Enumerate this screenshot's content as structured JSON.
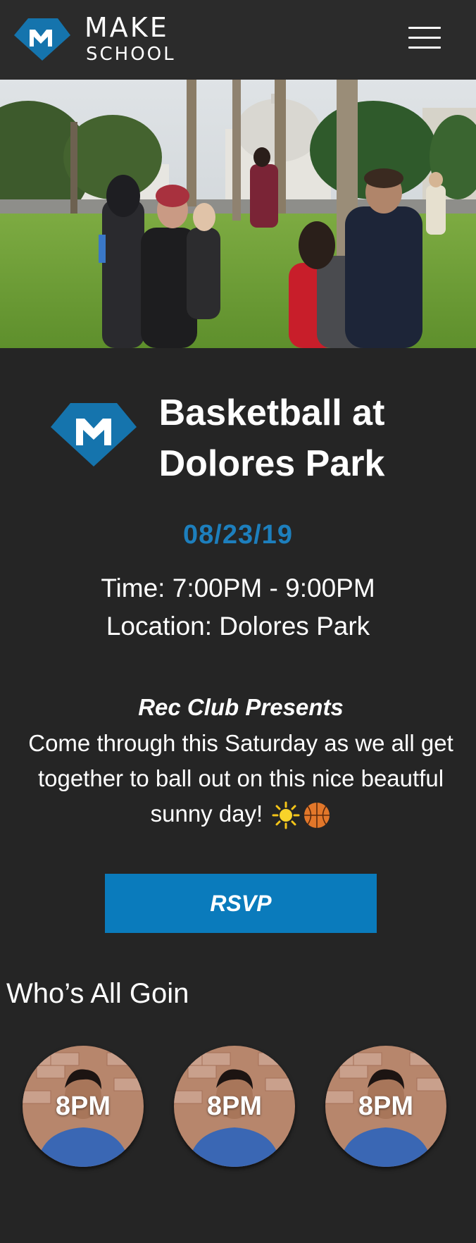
{
  "header": {
    "brand_line1": "MAKE",
    "brand_line2": "SCHOOL",
    "logo_icon": "make-school-m-diamond",
    "menu_icon": "hamburger-menu",
    "accent_color": "#1d7fbd"
  },
  "event": {
    "title": "Basketball at Dolores Park",
    "date": "08/23/19",
    "time": "Time: 7:00PM - 9:00PM",
    "location": "Location: Dolores Park",
    "presenter": "Rec Club Presents",
    "description": "Come through this Saturday as we all get together to ball out on this nice beautful sunny day!",
    "description_emojis": [
      "sun",
      "basketball"
    ],
    "rsvp_label": "RSVP"
  },
  "attendees": {
    "heading": "Who’s All Goin",
    "items": [
      {
        "label": "8PM"
      },
      {
        "label": "8PM"
      },
      {
        "label": "8PM"
      }
    ]
  }
}
